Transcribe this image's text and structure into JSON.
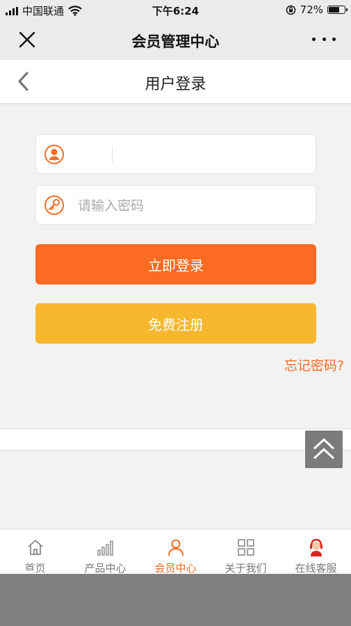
{
  "status_bar": {
    "carrier": "中国联通",
    "time": "下午6:24",
    "battery_text": "72%",
    "battery_level": 0.72
  },
  "wechat_bar": {
    "title": "会员管理中心",
    "close_icon": "close-icon",
    "more_icon": "more-dots-icon"
  },
  "header": {
    "title": "用户登录",
    "back_icon": "chevron-left-icon"
  },
  "form": {
    "username": {
      "value": "",
      "placeholder": "",
      "icon": "user-icon"
    },
    "password": {
      "value": "",
      "placeholder": "请输入密码",
      "icon": "key-icon"
    },
    "login_label": "立即登录",
    "register_label": "免费注册",
    "forgot_label": "忘记密码?"
  },
  "back_to_top_icon": "double-chevron-up-icon",
  "tabbar": {
    "items": [
      {
        "label": "首页",
        "icon": "home-icon",
        "active": false
      },
      {
        "label": "产品中心",
        "icon": "bar-chart-icon",
        "active": false
      },
      {
        "label": "会员中心",
        "icon": "person-icon",
        "active": true
      },
      {
        "label": "关于我们",
        "icon": "grid-icon",
        "active": false
      },
      {
        "label": "在线客服",
        "icon": "customer-service-icon",
        "active": false
      }
    ]
  },
  "colors": {
    "accent": "#f26c23",
    "login_button": "#fb6b22",
    "register_button": "#f6b72e",
    "page_bg": "#f2f2f2"
  }
}
